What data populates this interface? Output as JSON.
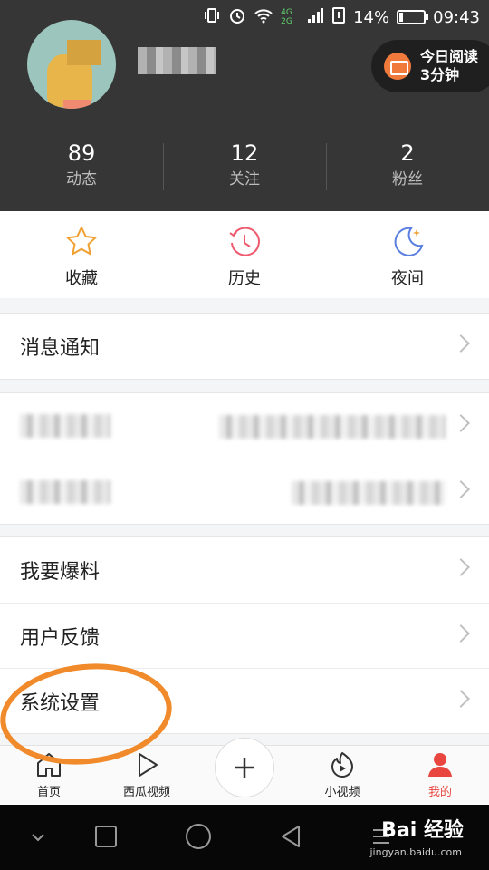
{
  "status_bar": {
    "network": "4G 2G",
    "battery": "14%",
    "time": "09:43",
    "battery_level": 0.14
  },
  "profile": {
    "read_pill": {
      "line1": "今日阅读",
      "line2": "3分钟"
    },
    "stats": [
      {
        "value": "89",
        "label": "动态"
      },
      {
        "value": "12",
        "label": "关注"
      },
      {
        "value": "2",
        "label": "粉丝"
      }
    ]
  },
  "quick_actions": [
    {
      "label": "收藏",
      "icon": "star-icon"
    },
    {
      "label": "历史",
      "icon": "clock-icon"
    },
    {
      "label": "夜间",
      "icon": "moon-icon"
    }
  ],
  "menu": {
    "notifications": "消息通知",
    "report": "我要爆料",
    "feedback": "用户反馈",
    "settings": "系统设置"
  },
  "tabbar": [
    {
      "label": "首页",
      "icon": "home-icon"
    },
    {
      "label": "西瓜视频",
      "icon": "play-icon"
    },
    {
      "label": "小视频",
      "icon": "short-video-icon"
    },
    {
      "label": "我的",
      "icon": "person-icon"
    }
  ],
  "watermark": {
    "brand": "Bai 经验",
    "url": "jingyan.baidu.com"
  },
  "colors": {
    "accent": "#e8463f",
    "header_bg": "#363636",
    "annotation": "#f08a2a"
  }
}
